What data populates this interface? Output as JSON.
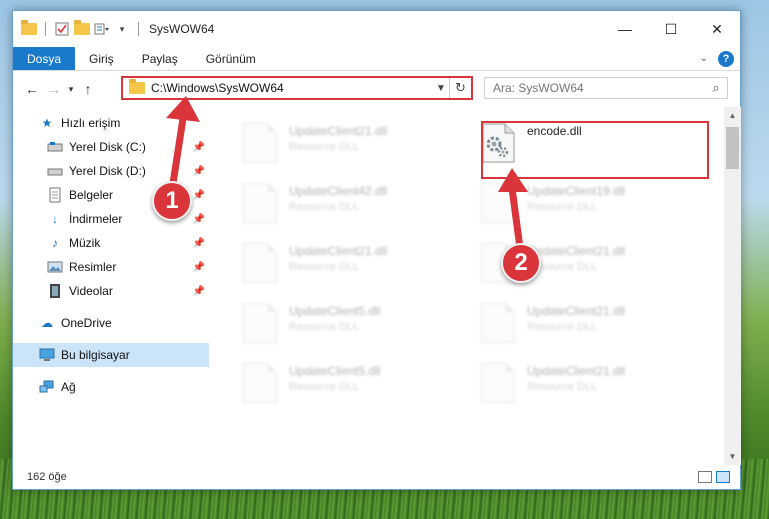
{
  "window": {
    "title": "SysWOW64",
    "controls": {
      "minimize": "—",
      "maximize": "☐",
      "close": "✕"
    }
  },
  "ribbon": {
    "tabs": [
      "Dosya",
      "Giriş",
      "Paylaş",
      "Görünüm"
    ],
    "help": "?"
  },
  "address": {
    "path": "C:\\Windows\\SysWOW64",
    "search_placeholder": "Ara: SysWOW64"
  },
  "sidebar": {
    "quick_access": "Hızlı erişim",
    "items": [
      {
        "label": "Yerel Disk (C:)",
        "icon": "drive-icon"
      },
      {
        "label": "Yerel Disk (D:)",
        "icon": "drive-icon"
      },
      {
        "label": "Belgeler",
        "icon": "documents-icon"
      },
      {
        "label": "İndirmeler",
        "icon": "download-icon"
      },
      {
        "label": "Müzik",
        "icon": "music-icon"
      },
      {
        "label": "Resimler",
        "icon": "pictures-icon"
      },
      {
        "label": "Videolar",
        "icon": "video-icon"
      }
    ],
    "onedrive": "OneDrive",
    "this_pc": "Bu bilgisayar",
    "network": "Ağ"
  },
  "files": {
    "left_column": [
      {
        "name": "UpdateClient21.dll",
        "desc": "Resource DLL"
      },
      {
        "name": "UpdateClient42.dll",
        "desc": "Resource DLL"
      },
      {
        "name": "UpdateClient21.dll",
        "desc": "Resource DLL"
      },
      {
        "name": "UpdateClient5.dll",
        "desc": "Resource DLL"
      },
      {
        "name": "UpdateClient5.dll",
        "desc": "Resource DLL"
      }
    ],
    "right_column": [
      {
        "name": "encode.dll",
        "desc": ""
      },
      {
        "name": "UpdateClient19.dll",
        "desc": "Resource DLL"
      },
      {
        "name": "UpdateClient21.dll",
        "desc": "Resource DLL"
      },
      {
        "name": "UpdateClient21.dll",
        "desc": "Resource DLL"
      },
      {
        "name": "UpdateClient21.dll",
        "desc": "Resource DLL"
      }
    ]
  },
  "status": {
    "item_count": "162 öğe"
  },
  "markers": {
    "one": "1",
    "two": "2"
  },
  "colors": {
    "accent": "#1979ca",
    "highlight": "#d9353a",
    "selected": "#cce4f7"
  }
}
